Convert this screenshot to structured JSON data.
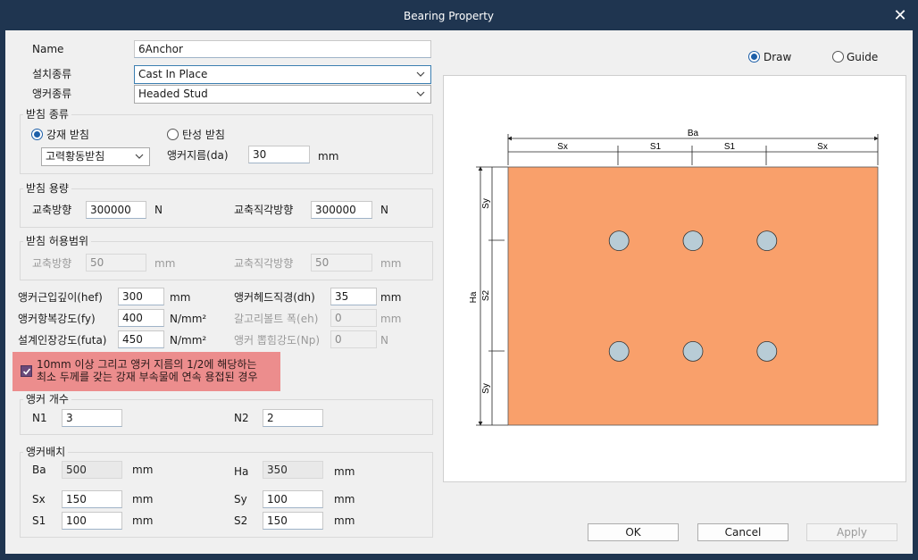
{
  "window": {
    "title": "Bearing Property",
    "close_icon": "close-icon"
  },
  "general": {
    "name_label": "Name",
    "name_value": "6Anchor",
    "install_label": "설치종류",
    "install_value": "Cast In Place",
    "anchor_type_label": "앵커종류",
    "anchor_type_value": "Headed Stud"
  },
  "bearing_type": {
    "title": "받침 종류",
    "steel_label": "강재 받침",
    "steel_selected": true,
    "elastic_label": "탄성 받침",
    "sub_value": "고력황동받침",
    "diameter_label": "앵커지름(da)",
    "diameter_value": "30",
    "diameter_unit": "mm"
  },
  "capacity": {
    "title": "받침 용량",
    "axial_label": "교축방향",
    "axial_value": "300000",
    "axial_unit": "N",
    "perp_label": "교축직각방향",
    "perp_value": "300000",
    "perp_unit": "N"
  },
  "allowance": {
    "title": "받침 허용범위",
    "axial_label": "교축방향",
    "axial_value": "50",
    "axial_unit": "mm",
    "perp_label": "교축직각방향",
    "perp_value": "50",
    "perp_unit": "mm"
  },
  "props": {
    "hef_label": "앵커근입깊이(hef)",
    "hef_value": "300",
    "hef_unit": "mm",
    "dh_label": "앵커헤드직경(dh)",
    "dh_value": "35",
    "dh_unit": "mm",
    "fy_label": "앵커항복강도(fy)",
    "fy_value": "400",
    "fy_unit": "N/mm²",
    "eh_label": "갈고리볼트 폭(eh)",
    "eh_value": "0",
    "eh_unit": "mm",
    "futa_label": "설계인장강도(futa)",
    "futa_value": "450",
    "futa_unit": "N/mm²",
    "np_label": "앵커 뽑힘강도(Np)",
    "np_value": "0",
    "np_unit": "N"
  },
  "warning": {
    "checked": true,
    "line1": "10mm 이상 그리고 앵커 지름의 1/2에 해당하는",
    "line2": "최소 두께를 갖는 강재 부속물에 연속 용접된 경우"
  },
  "count": {
    "title": "앵커 개수",
    "n1_label": "N1",
    "n1_value": "3",
    "n2_label": "N2",
    "n2_value": "2"
  },
  "layout": {
    "title": "앵커배치",
    "ba_label": "Ba",
    "ba_value": "500",
    "ba_unit": "mm",
    "ha_label": "Ha",
    "ha_value": "350",
    "ha_unit": "mm",
    "sx_label": "Sx",
    "sx_value": "150",
    "sx_unit": "mm",
    "sy_label": "Sy",
    "sy_value": "100",
    "sy_unit": "mm",
    "s1_label": "S1",
    "s1_value": "100",
    "s1_unit": "mm",
    "s2_label": "S2",
    "s2_value": "150",
    "s2_unit": "mm"
  },
  "view": {
    "draw_label": "Draw",
    "guide_label": "Guide",
    "draw_selected": true
  },
  "drawing": {
    "plate_color": "#f9a06b",
    "hole_color": "#b8ccd6",
    "dim_ba": "Ba",
    "dim_sx": "Sx",
    "dim_s1": "S1",
    "dim_ha": "Ha",
    "dim_sy": "Sy",
    "dim_s2": "S2"
  },
  "buttons": {
    "ok": "OK",
    "cancel": "Cancel",
    "apply": "Apply"
  }
}
